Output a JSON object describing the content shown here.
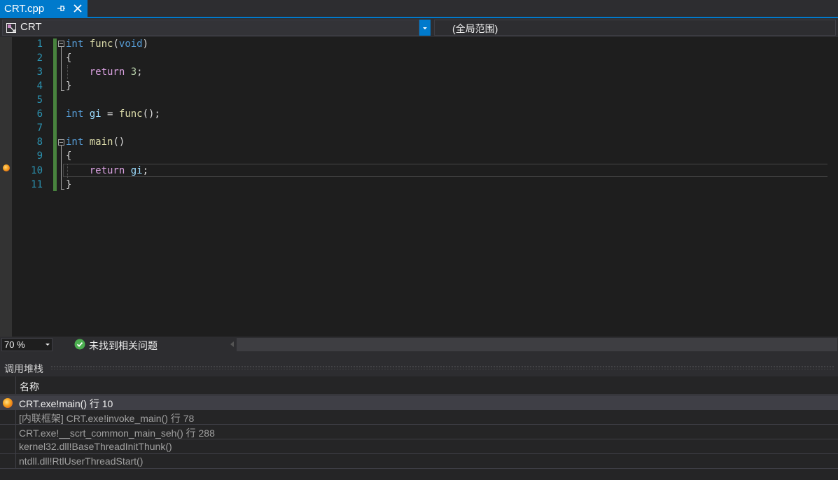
{
  "tab": {
    "label": "CRT.cpp",
    "pin_icon": "pin-icon",
    "close_icon": "close-icon",
    "accent": "#007acc"
  },
  "navbar": {
    "project": "CRT",
    "scope": "(全局范围)"
  },
  "editor": {
    "line_numbers": [
      "1",
      "2",
      "3",
      "4",
      "5",
      "6",
      "7",
      "8",
      "9",
      "10",
      "11"
    ],
    "breakpoint_line": 10,
    "colors": {
      "keyword": "#569cd6",
      "control": "#d8a0df",
      "function": "#dcdcaa",
      "variable": "#9cdcfe",
      "number": "#b5cea8",
      "line_number": "#2b91af"
    },
    "code": {
      "l1": {
        "kw": "int",
        "sp": " ",
        "fn": "func",
        "p1": "(",
        "kw2": "void",
        "p2": ")"
      },
      "l2": {
        "text": "{"
      },
      "l3": {
        "indent": "    ",
        "ctrl": "return",
        "sp": " ",
        "num": "3",
        "end": ";"
      },
      "l4": {
        "text": "}"
      },
      "l6": {
        "kw": "int",
        "sp1": " ",
        "var": "gi",
        "eq": " = ",
        "fn": "func",
        "end": "();"
      },
      "l8": {
        "kw": "int",
        "sp": " ",
        "fn": "main",
        "end": "()"
      },
      "l9": {
        "text": "{"
      },
      "l10": {
        "indent": "    ",
        "ctrl": "return",
        "sp": " ",
        "var": "gi",
        "end": ";"
      },
      "l11": {
        "text": "}"
      }
    }
  },
  "status": {
    "zoom": "70 %",
    "issues": "未找到相关问题"
  },
  "callstack": {
    "title": "调用堆栈",
    "column_name": "名称",
    "rows": [
      {
        "text": "CRT.exe!main() 行 10"
      },
      {
        "text": "[内联框架] CRT.exe!invoke_main() 行 78"
      },
      {
        "text": "CRT.exe!__scrt_common_main_seh() 行 288"
      },
      {
        "text": "kernel32.dll!BaseThreadInitThunk()"
      },
      {
        "text": "ntdll.dll!RtlUserThreadStart()"
      }
    ]
  }
}
